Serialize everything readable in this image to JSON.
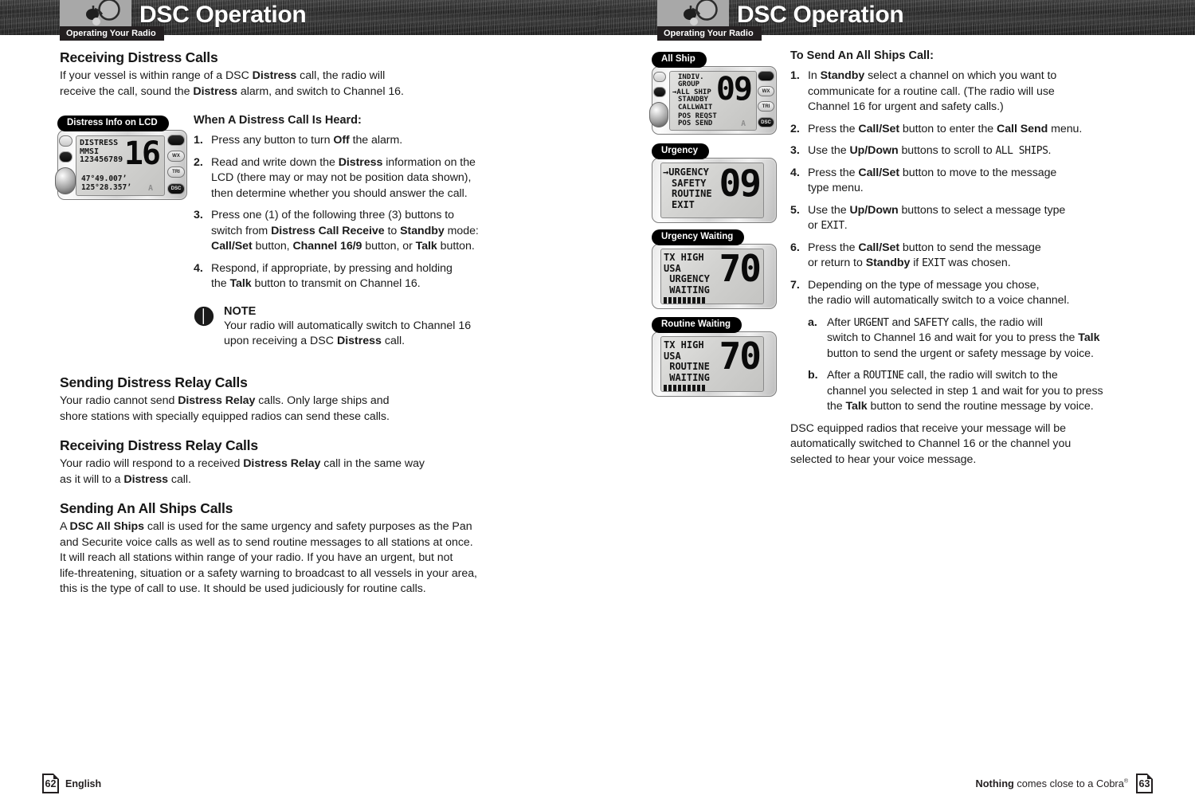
{
  "header": {
    "title": "DSC Operation",
    "breadcrumb": "Operating Your Radio",
    "logo_icon": "microphone-icon"
  },
  "left_page": {
    "sections": [
      {
        "heading": "Receiving Distress Calls",
        "paragraph": "If your vessel is within range of a DSC Distress call, the radio will receive the call, sound the Distress alarm, and switch to Channel 16."
      }
    ],
    "figure": {
      "label": "Distress Info on LCD",
      "lcd": {
        "line1": "DISTRESS",
        "line2": "MMSI",
        "line3": "123456789",
        "line4": "47°49.007’",
        "line5": "125°28.357’",
        "band": "A",
        "channel": "16"
      }
    },
    "procedure": {
      "title": "When A Distress Call Is Heard:",
      "steps": [
        {
          "n": "1.",
          "text": "Press any button to turn Off the alarm."
        },
        {
          "n": "2.",
          "text": "Read and write down the Distress information on the LCD (there may or may not be position data shown), then determine whether you should answer the call."
        },
        {
          "n": "3.",
          "text": "Press one (1) of the following three (3) buttons to switch from Distress Call Receive to Standby mode: Call/Set button, Channel 16/9 button, or Talk button."
        },
        {
          "n": "4.",
          "text": "Respond, if appropriate, by pressing and holding the Talk button to transmit on Channel 16."
        }
      ]
    },
    "note": {
      "icon": "note-knob-icon",
      "title": "NOTE",
      "text": "Your radio will automatically switch to Channel 16 upon receiving a DSC Distress call."
    },
    "more_sections": [
      {
        "heading": "Sending Distress Relay Calls",
        "paragraph": "Your radio cannot send Distress Relay calls. Only large ships and shore stations with specially equipped radios can send these calls."
      },
      {
        "heading": "Receiving Distress Relay Calls",
        "paragraph": "Your radio will respond to a received Distress Relay call in the same way as it will to a Distress call."
      },
      {
        "heading": "Sending An All Ships Calls",
        "paragraph": "A DSC All Ships call is used for the same urgency and safety purposes as the Pan and Securite voice calls as well as to send routine messages to all stations at once. It will reach all stations within range of your radio. If you have an urgent, but not life-threatening, situation or a safety warning to broadcast to all vessels in your area, this is the type of call to use. It should be used judiciously for routine calls."
      }
    ],
    "footer": {
      "page": "62",
      "language": "English"
    }
  },
  "right_page": {
    "figures": [
      {
        "label": "All Ship",
        "menu": [
          "INDIV.",
          "GROUP",
          "ALL SHIP",
          "STANDBY",
          "CALLWAIT",
          "POS REQST",
          "POS SEND"
        ],
        "selected": "ALL SHIP",
        "band": "A",
        "channel": "09"
      },
      {
        "label": "Urgency",
        "menu": [
          "URGENCY",
          "SAFETY",
          "ROUTINE",
          "EXIT"
        ],
        "selected": "URGENCY",
        "band": "",
        "channel": "09"
      },
      {
        "label": "Urgency Waiting",
        "lines": [
          "TX HIGH",
          "USA",
          " URGENCY",
          " WAITING"
        ],
        "bars": 9,
        "channel": "70"
      },
      {
        "label": "Routine Waiting",
        "lines": [
          "TX HIGH",
          "USA",
          " ROUTINE",
          " WAITING"
        ],
        "bars": 9,
        "channel": "70"
      }
    ],
    "procedure": {
      "title": "To Send An All Ships Call:",
      "steps": [
        {
          "n": "1.",
          "text": "In Standby select a channel on which you want to communicate for a routine call. (The radio will use Channel 16 for urgent and safety calls.)"
        },
        {
          "n": "2.",
          "text": "Press the Call/Set button to enter the Call Send menu."
        },
        {
          "n": "3.",
          "text": "Use the Up/Down buttons to scroll to ALL SHIPS."
        },
        {
          "n": "4.",
          "text": "Press the Call/Set button to move to the message type menu."
        },
        {
          "n": "5.",
          "text": "Use the Up/Down buttons to select a message type or EXIT."
        },
        {
          "n": "6.",
          "text": "Press the Call/Set button to send the message or return to Standby if EXIT was chosen."
        },
        {
          "n": "7.",
          "text": "Depending on the type of message you chose, the radio will automatically switch to a voice channel."
        }
      ],
      "substeps": [
        {
          "n": "a.",
          "text": "After URGENT and SAFETY calls, the radio will switch to Channel 16 and wait for you to press the Talk button to send the urgent or safety message by voice."
        },
        {
          "n": "b.",
          "text": "After a ROUTINE call, the radio will switch to the channel you selected in step 1 and wait for you to press the Talk button to send the routine message by voice."
        }
      ],
      "closing": "DSC equipped radios that receive your message will be automatically switched to Channel 16 or the channel you selected to hear your voice message."
    },
    "footer": {
      "page": "63",
      "tagline_bold": "Nothing",
      "tagline_rest": " comes close to a Cobra",
      "tagline_mark": "®"
    }
  }
}
